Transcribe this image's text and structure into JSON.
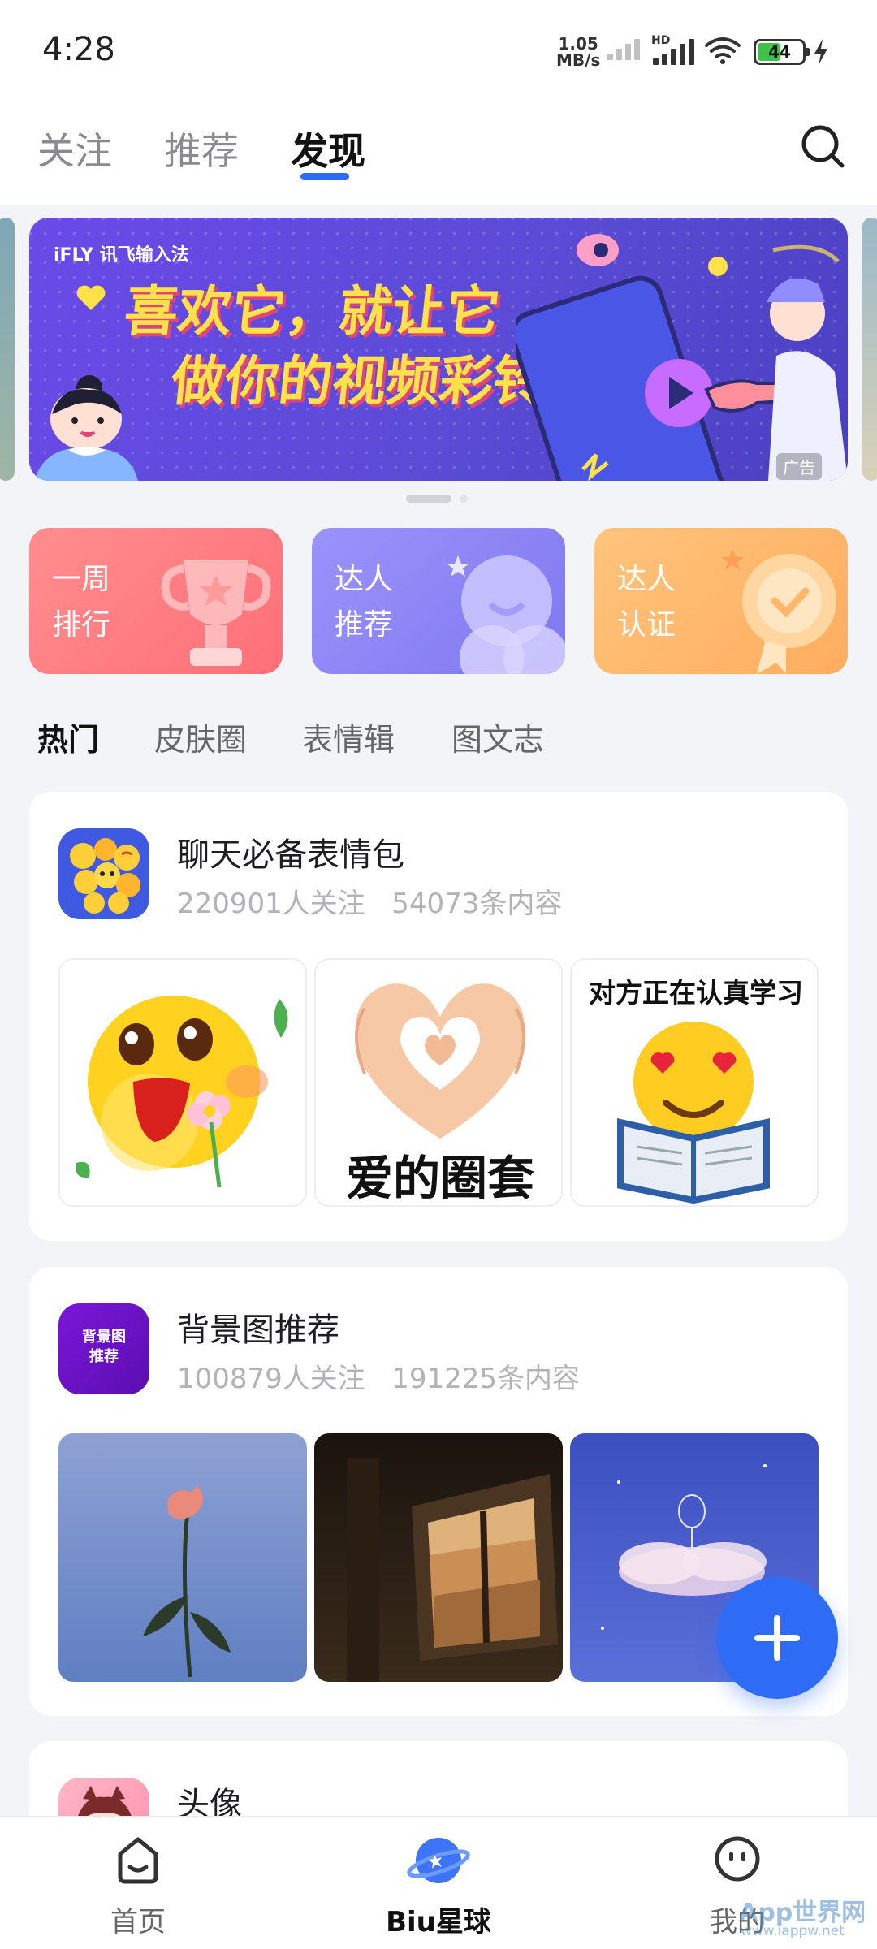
{
  "status_bar": {
    "time": "4:28",
    "net_rate_value": "1.05",
    "net_rate_unit": "MB/s",
    "hd_label": "HD",
    "battery": "44"
  },
  "top_tabs": [
    {
      "label": "关注",
      "active": false
    },
    {
      "label": "推荐",
      "active": false
    },
    {
      "label": "发现",
      "active": true
    }
  ],
  "banner": {
    "brand": "iFLY 讯飞输入法",
    "line1": "喜欢它，就让它",
    "line2": "做你的视频彩铃",
    "ad_label": "广告"
  },
  "quick_cards": [
    {
      "label": "一周\n排行",
      "color": "#ff7b7b"
    },
    {
      "label": "达人\n推荐",
      "color": "#8f86f5"
    },
    {
      "label": "达人\n认证",
      "color": "#ffb86a"
    }
  ],
  "category_tabs": [
    {
      "label": "热门",
      "active": true
    },
    {
      "label": "皮肤圈",
      "active": false
    },
    {
      "label": "表情辑",
      "active": false
    },
    {
      "label": "图文志",
      "active": false
    }
  ],
  "sections": [
    {
      "title": "聊天必备表情包",
      "followers": "220901人关注",
      "contents": "54073条内容",
      "thumbs": [
        {
          "caption": ""
        },
        {
          "caption": "爱的圈套"
        },
        {
          "caption": "对方正在认真学习"
        }
      ]
    },
    {
      "title": "背景图推荐",
      "avatar_text": "背景图\n推荐",
      "followers": "100879人关注",
      "contents": "191225条内容",
      "thumbs": []
    },
    {
      "title": "头像",
      "followers": "",
      "contents": ""
    }
  ],
  "bottom_nav": [
    {
      "label": "首页",
      "active": false
    },
    {
      "label": "Biu星球",
      "active": true
    },
    {
      "label": "我的",
      "active": false
    }
  ],
  "watermark": {
    "main": "App世界网",
    "url": "www.iappw.net"
  },
  "colors": {
    "accent": "#2f6cf6",
    "page_bg": "#f3f4f8"
  }
}
